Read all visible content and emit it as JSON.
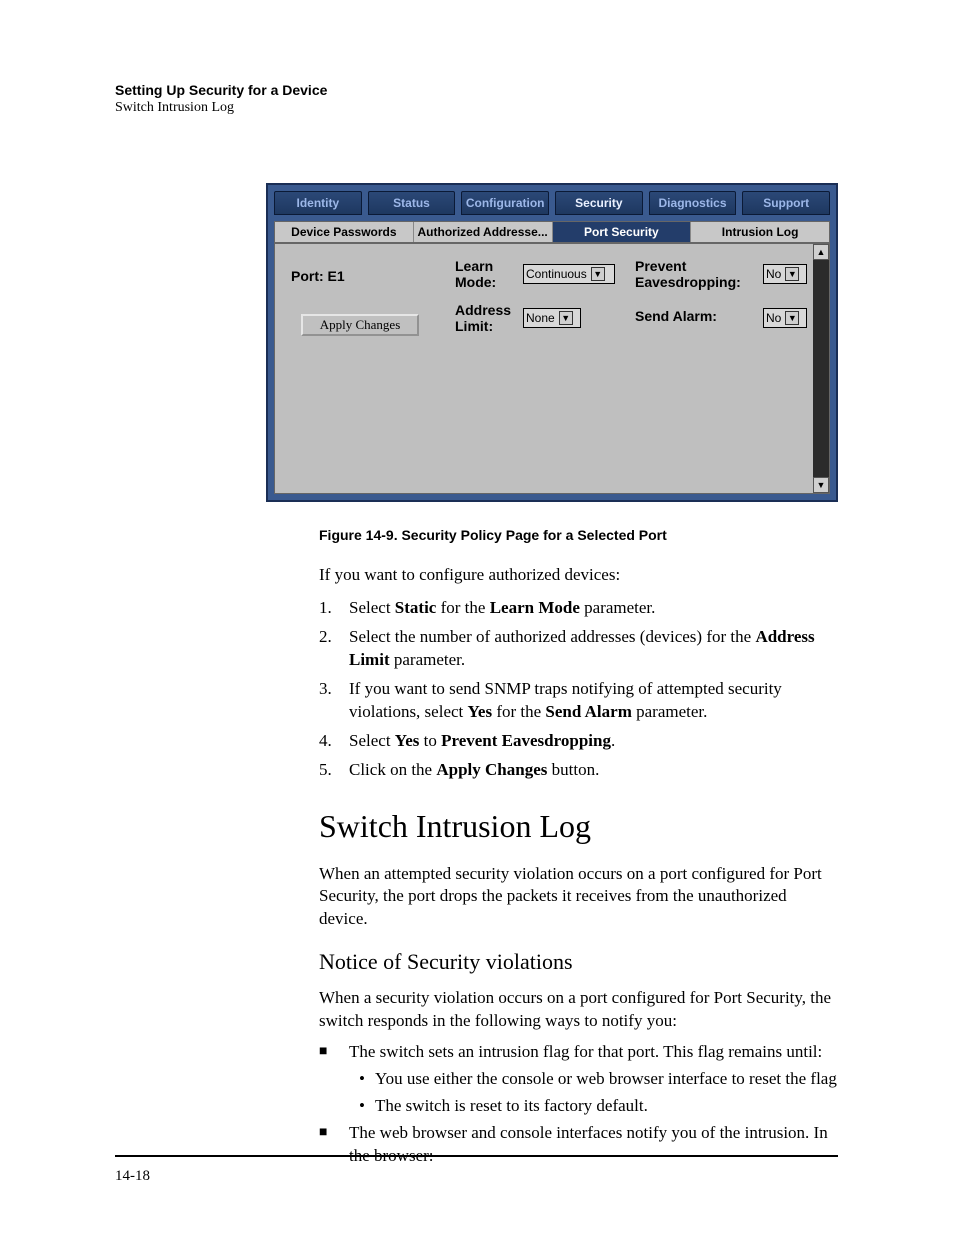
{
  "header": {
    "title": "Setting Up Security for a Device",
    "subtitle": "Switch Intrusion Log"
  },
  "app": {
    "tabs": [
      "Identity",
      "Status",
      "Configuration",
      "Security",
      "Diagnostics",
      "Support"
    ],
    "active_tab_index": 3,
    "subtabs": [
      "Device Passwords",
      "Authorized Addresse...",
      "Port Security",
      "Intrusion Log"
    ],
    "active_subtab_index": 2,
    "form": {
      "port_label": "Port:  E1",
      "learn_mode_label": "Learn Mode:",
      "learn_mode_value": "Continuous",
      "address_limit_label": "Address Limit:",
      "address_limit_value": "None",
      "prevent_eaves_label": "Prevent Eavesdropping:",
      "prevent_eaves_value": "No",
      "send_alarm_label": "Send Alarm:",
      "send_alarm_value": "No",
      "apply_button": "Apply Changes"
    }
  },
  "figure_caption": "Figure 14-9.  Security Policy Page for a Selected Port",
  "body": {
    "intro": "If you want to configure authorized devices:",
    "steps": [
      {
        "pre": "Select ",
        "b1": "Static",
        "mid": " for the ",
        "b2": "Learn Mode",
        "post": " parameter."
      },
      {
        "pre": "Select the number of authorized addresses (devices) for the ",
        "b1": "Address Limit",
        "mid": "",
        "b2": "",
        "post": " parameter."
      },
      {
        "pre": "If you want to send SNMP traps notifying of attempted security violations, select ",
        "b1": "Yes",
        "mid": " for the ",
        "b2": "Send Alarm",
        "post": " parameter."
      },
      {
        "pre": "Select ",
        "b1": "Yes",
        "mid": " to ",
        "b2": "Prevent Eavesdropping",
        "post": "."
      },
      {
        "pre": "Click on the ",
        "b1": "Apply Changes",
        "mid": "",
        "b2": "",
        "post": " button."
      }
    ],
    "h1": "Switch Intrusion Log",
    "para1": "When an attempted security violation occurs on a port configured for Port Security, the port drops the packets it receives from the unauthorized device.",
    "h2": "Notice of Security violations",
    "para2": "When a security violation occurs on a port configured for Port Security, the switch responds in the following ways to notify you:",
    "bullets": [
      {
        "text": "The switch sets an intrusion flag for that port. This flag remains until:",
        "sub": [
          "You use either the console or web browser interface to reset the flag",
          "The switch is reset to its factory default."
        ]
      },
      {
        "text": "The web browser and console interfaces notify you of the intrusion. In the browser:",
        "sub": []
      }
    ]
  },
  "page_number": "14-18"
}
